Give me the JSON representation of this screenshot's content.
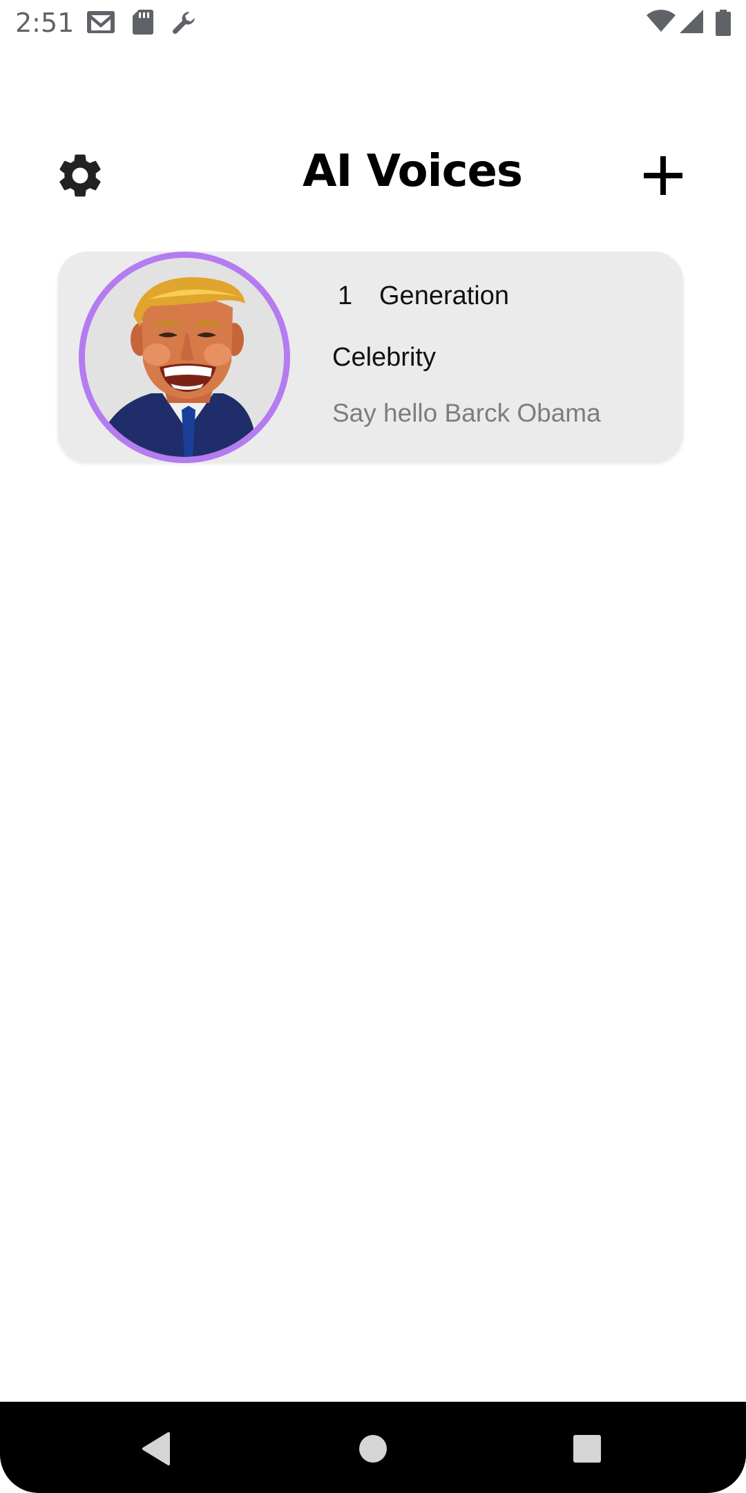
{
  "status_bar": {
    "time": "2:51",
    "left_icons": [
      "gmail-icon",
      "sd-card-icon",
      "wrench-icon"
    ],
    "right_icons": [
      "wifi-icon",
      "cell-signal-icon",
      "battery-icon"
    ]
  },
  "header": {
    "title": "AI Voices",
    "settings_icon": "gear-icon",
    "add_icon": "plus-icon"
  },
  "voices": [
    {
      "generations": "1",
      "generation_label": "Generation",
      "category": "Celebrity",
      "text": "Say hello Barck Obama",
      "avatar_icon": "cartoon-man-avatar",
      "ring_color": "#b57bf0"
    }
  ],
  "nav_bar": {
    "back_icon": "back-triangle-icon",
    "home_icon": "home-circle-icon",
    "recents_icon": "recents-square-icon"
  }
}
